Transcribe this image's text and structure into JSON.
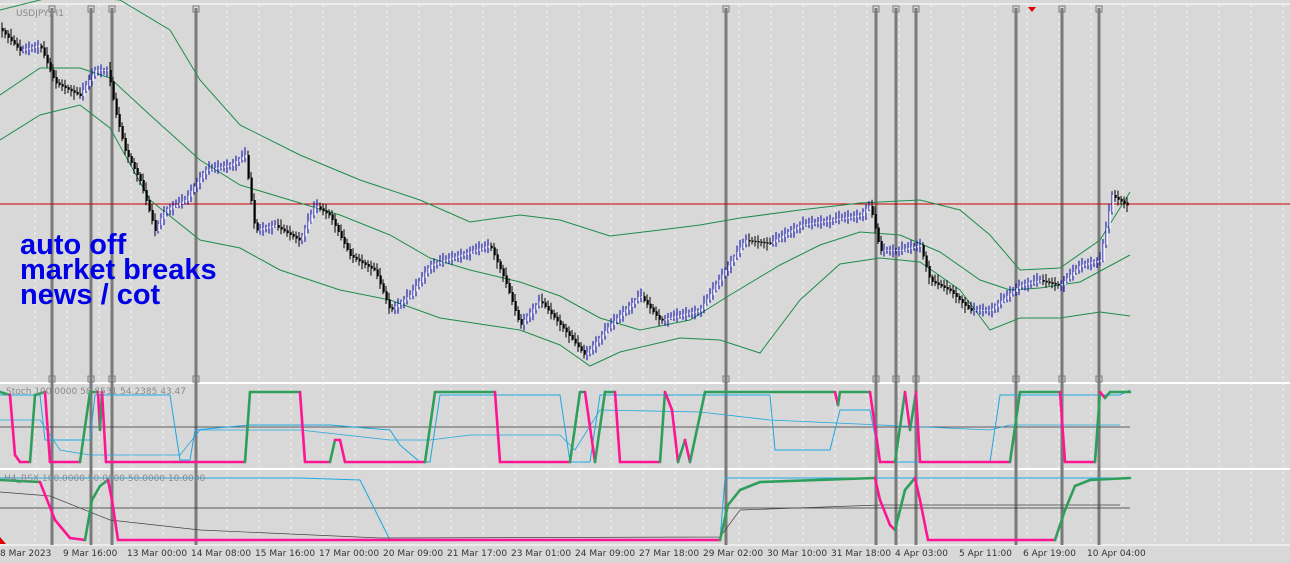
{
  "symbol_label": "USDJPY,H1",
  "overlay_text": [
    "auto off",
    "market breaks",
    "news / cot"
  ],
  "indicator1_label": "Stoch 100.0000 58.8531 54.2385 43.47",
  "indicator2_label": "H4_RSX 100.0000 50.0000 50.0000 10.0000",
  "x_axis_labels": [
    "8 Mar 2023",
    "9 Mar 16:00",
    "13 Mar 00:00",
    "14 Mar 08:00",
    "15 Mar 16:00",
    "17 Mar 00:00",
    "20 Mar 09:00",
    "21 Mar 17:00",
    "23 Mar 01:00",
    "24 Mar 09:00",
    "27 Mar 18:00",
    "29 Mar 02:00",
    "30 Mar 10:00",
    "31 Mar 18:00",
    "4 Apr 03:00",
    "5 Apr 11:00",
    "6 Apr 19:00",
    "10 Apr 04:00"
  ],
  "colors": {
    "background": "#d8d8d8",
    "grid": "#f2f2f2",
    "price_line": "#cc0000",
    "bollinger": "#1e8c4a",
    "bar_up": "#ffffff",
    "bar_down": "#000000",
    "bar_up_edge": "#0000aa",
    "session_line": "#7a7a7a",
    "osc_fast": "#ff1493",
    "osc_slow": "#2e9e5b",
    "osc_signal": "#1ea7e0",
    "osc_level": "#333333",
    "overlay_text": "#0000e6"
  },
  "markers": [
    "triangle-down-icon"
  ]
}
